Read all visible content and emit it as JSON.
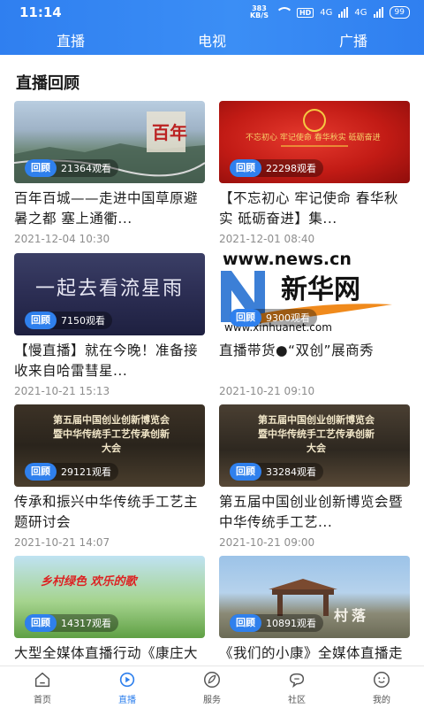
{
  "status": {
    "time": "11:14",
    "speed_top": "383",
    "speed_bottom": "KB/S",
    "hd": "HD",
    "net1": "4G",
    "net2": "4G",
    "battery": "99"
  },
  "top_tabs": [
    {
      "label": "直播"
    },
    {
      "label": "电视"
    },
    {
      "label": "广播"
    }
  ],
  "section_title": "直播回顾",
  "badge_label": "回顾",
  "cards": [
    {
      "views": "21364观看",
      "title": "百年百城——走进中国草原避暑之都 塞上通衢...",
      "date": "2021-12-04 10:30",
      "thumb_text": "百年"
    },
    {
      "views": "22298观看",
      "title": "【不忘初心 牢记使命 春华秋实 砥砺奋进】集...",
      "date": "2021-12-01 08:40",
      "thumb_text": "不忘初心 牢记使命 春华秋实 砥砺奋进"
    },
    {
      "views": "7150观看",
      "title": "【慢直播】就在今晚！准备接收来自哈雷彗星...",
      "date": "2021-10-21 15:13",
      "thumb_text": "一起去看流星雨"
    },
    {
      "views": "9300观看",
      "title": "直播带货●“双创”展商秀",
      "date": "2021-10-21 09:10",
      "thumb_text_top": "www.news.cn",
      "thumb_text_mid": "新华网",
      "thumb_text_bottom": "www.xinhuanet.com"
    },
    {
      "views": "29121观看",
      "title": "传承和振兴中华传统手工艺主题研讨会",
      "date": "2021-10-21 14:07",
      "thumb_text": "第五届中国创业创新博览会 暨中华传统手工艺传承创新大会"
    },
    {
      "views": "33284观看",
      "title": "第五届中国创业创新博览会暨中华传统手工艺...",
      "date": "2021-10-21 09:00",
      "thumb_text": "第五届中国创业创新博览会 暨中华传统手工艺传承创新大会"
    },
    {
      "views": "14317观看",
      "title": "大型全媒体直播行动《康庄大道》乡村寻乐...",
      "date": "",
      "thumb_text": "乡村绿色 欢乐的歌"
    },
    {
      "views": "10891观看",
      "title": "《我们的小康》全媒体直播走镜篇...",
      "date": "",
      "thumb_text": "村落"
    }
  ],
  "bottom_nav": [
    {
      "label": "首页",
      "icon": "home-icon"
    },
    {
      "label": "直播",
      "icon": "live-icon"
    },
    {
      "label": "服务",
      "icon": "leaf-icon"
    },
    {
      "label": "社区",
      "icon": "chat-icon"
    },
    {
      "label": "我的",
      "icon": "smile-icon"
    }
  ],
  "colors": {
    "accent": "#2f80ed",
    "header": "#3b8ef5"
  }
}
